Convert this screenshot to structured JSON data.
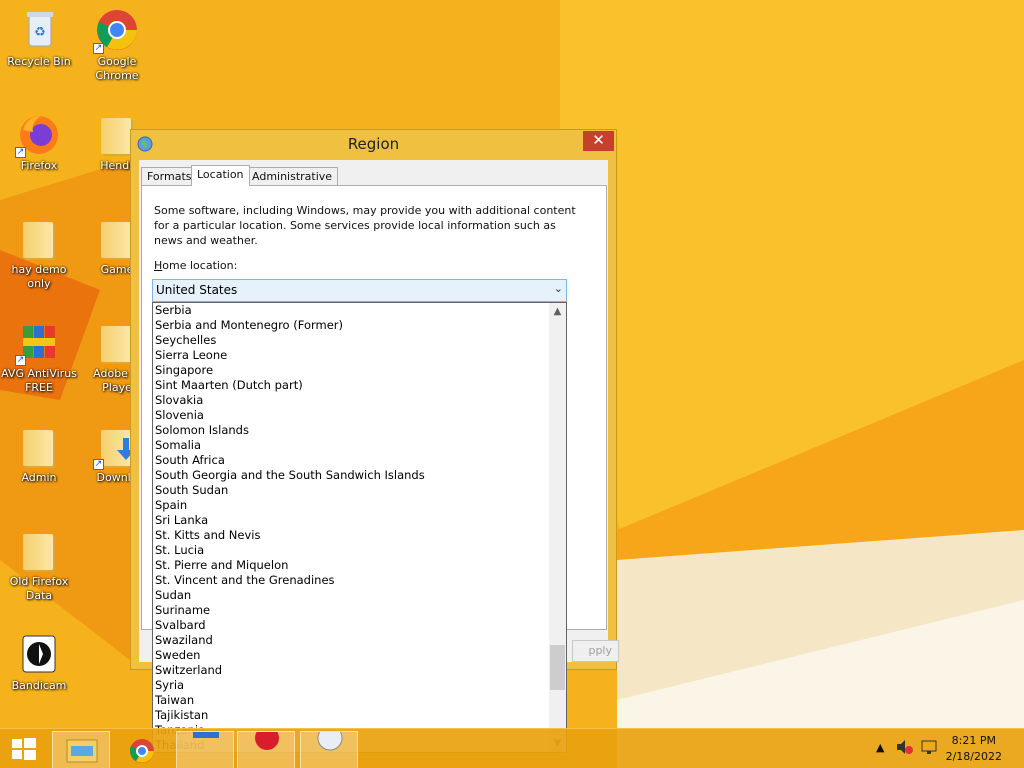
{
  "desktop": {
    "icons": [
      {
        "label": "Recycle Bin"
      },
      {
        "label": "Google Chrome"
      },
      {
        "label": "Firefox"
      },
      {
        "label": "Hendr"
      },
      {
        "label": "hay demo only"
      },
      {
        "label": "Game"
      },
      {
        "label": "AVG AntiVirus FREE"
      },
      {
        "label": "Adobe Fl Playe"
      },
      {
        "label": "Admin"
      },
      {
        "label": "Downlo"
      },
      {
        "label": "Old Firefox Data"
      },
      {
        "label": "Bandicam"
      }
    ]
  },
  "dialog": {
    "title": "Region",
    "close_label": "✕",
    "tabs": [
      {
        "label": "Formats"
      },
      {
        "label": "Location"
      },
      {
        "label": "Administrative"
      }
    ],
    "active_tab": "Location",
    "description": "Some software, including Windows, may provide you with additional content for a particular location. Some services provide local information such as news and weather.",
    "home_location_label_prefix": "H",
    "home_location_label_rest": "ome location:",
    "home_location_value": "United States",
    "apply_label": "pply",
    "dropdown_items": [
      "Serbia",
      "Serbia and Montenegro (Former)",
      "Seychelles",
      "Sierra Leone",
      "Singapore",
      "Sint Maarten (Dutch part)",
      "Slovakia",
      "Slovenia",
      "Solomon Islands",
      "Somalia",
      "South Africa",
      "South Georgia and the South Sandwich Islands",
      "South Sudan",
      "Spain",
      "Sri Lanka",
      "St. Kitts and Nevis",
      "St. Lucia",
      "St. Pierre and Miquelon",
      "St. Vincent and the Grenadines",
      "Sudan",
      "Suriname",
      "Svalbard",
      "Swaziland",
      "Sweden",
      "Switzerland",
      "Syria",
      "Taiwan",
      "Tajikistan",
      "Tanzania",
      "Thailand"
    ]
  },
  "taskbar": {
    "time": "8:21 PM",
    "date": "2/18/2022"
  },
  "colors": {
    "desktop_bg": "#f6b21c",
    "window_frame": "#f0c040",
    "close_button": "#c7402e",
    "combo_highlight": "#e5f1fb"
  }
}
